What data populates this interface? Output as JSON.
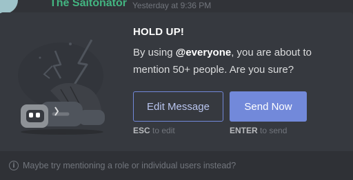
{
  "background_message": {
    "author": "The Saitonator",
    "timestamp": "Yesterday at 9:36 PM"
  },
  "modal": {
    "title": "HOLD UP!",
    "body_prefix": "By using ",
    "mention": "@everyone",
    "body_suffix": ", you are about to mention 50+ people. Are you sure?",
    "edit_button": "Edit Message",
    "send_button": "Send Now",
    "edit_key": "ESC",
    "edit_hint": " to edit",
    "send_key": "ENTER",
    "send_hint": " to send",
    "footer_tip": "Maybe try mentioning a role or individual users instead?",
    "info_icon_glyph": "i"
  },
  "colors": {
    "accent": "#7289da",
    "modal_bg": "#36393f",
    "footer_bg": "#2f3136",
    "author": "#43b581"
  }
}
